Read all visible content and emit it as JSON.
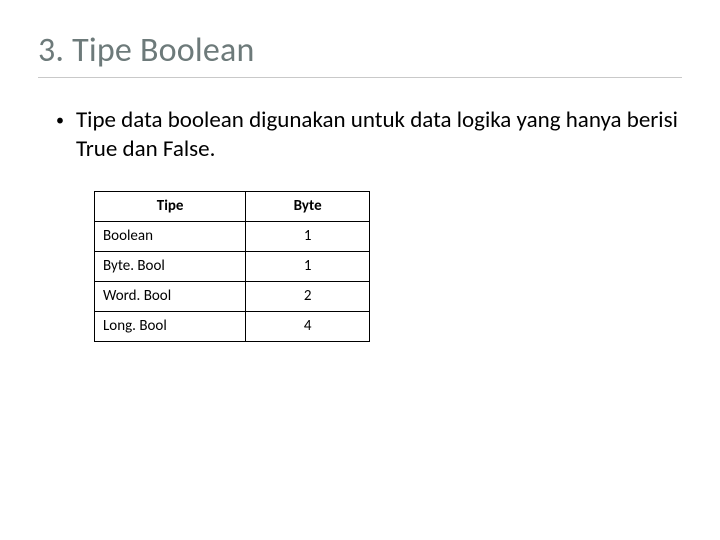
{
  "title": "3. Tipe Boolean",
  "bullet": "Tipe data boolean digunakan untuk data logika yang hanya berisi True dan False.",
  "table": {
    "headers": {
      "tipe": "Tipe",
      "byte": "Byte"
    },
    "rows": [
      {
        "tipe": "Boolean",
        "byte": "1"
      },
      {
        "tipe": "Byte. Bool",
        "byte": "1"
      },
      {
        "tipe": "Word. Bool",
        "byte": "2"
      },
      {
        "tipe": "Long. Bool",
        "byte": "4"
      }
    ]
  }
}
